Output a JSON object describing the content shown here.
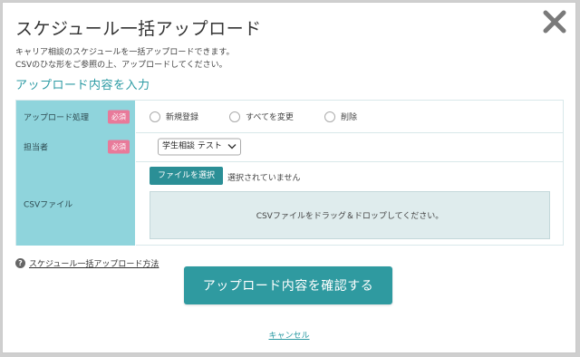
{
  "modal": {
    "title": "スケジュール一括アップロード",
    "description": [
      "キャリア相談のスケジュールを一括アップロードできます。",
      "CSVのひな形をご参照の上、アップロードしてください。"
    ],
    "section_title": "アップロード内容を入力"
  },
  "form": {
    "upload_process": {
      "label": "アップロード処理",
      "required": "必須",
      "options": [
        "新規登録",
        "すべてを変更",
        "削除"
      ]
    },
    "person_in_charge": {
      "label": "担当者",
      "required": "必須",
      "selected": "学生相談 テスト"
    },
    "csv_file": {
      "label": "CSVファイル",
      "button": "ファイルを選択",
      "status": "選択されていません",
      "dropzone": "CSVファイルをドラッグ＆ドロップしてください。"
    }
  },
  "help_link": "スケジュール一括アップロード方法",
  "confirm_button": "アップロード内容を確認する",
  "cancel_link": "キャンセル",
  "colors": {
    "accent": "#2f9aa0",
    "label_bg": "#8fd4dc",
    "required_badge": "#e87a9a",
    "dropzone_bg": "#dfeced"
  },
  "icons": {
    "close": "close-icon",
    "help": "question-icon",
    "select": "chevron-down-icon"
  }
}
